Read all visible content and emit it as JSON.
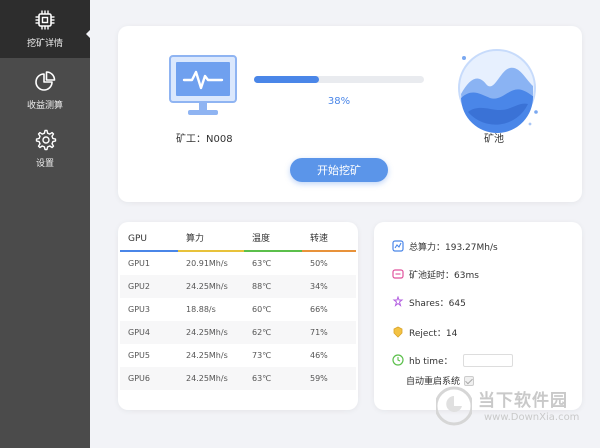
{
  "sidebar": {
    "items": [
      {
        "label": "挖矿详情",
        "icon": "chip-icon",
        "active": true
      },
      {
        "label": "收益测算",
        "icon": "pie-chart-icon",
        "active": false
      },
      {
        "label": "设置",
        "icon": "gear-icon",
        "active": false
      }
    ]
  },
  "mining": {
    "miner_label": "矿工：N008",
    "progress_text": "38%",
    "progress_value": 0.38,
    "pool_label": "矿池",
    "start_button": "开始挖矿"
  },
  "gpu_table": {
    "headers": [
      "GPU",
      "算力",
      "温度",
      "转速"
    ],
    "header_colors": [
      "#4a86e8",
      "#e8c23a",
      "#5bbf4b",
      "#e8923a"
    ],
    "rows": [
      [
        "GPU1",
        "20.91Mh/s",
        "63℃",
        "50%"
      ],
      [
        "GPU2",
        "24.25Mh/s",
        "88℃",
        "34%"
      ],
      [
        "GPU3",
        "18.88/s",
        "60℃",
        "66%"
      ],
      [
        "GPU4",
        "24.25Mh/s",
        "62℃",
        "71%"
      ],
      [
        "GPU5",
        "24.25Mh/s",
        "73℃",
        "46%"
      ],
      [
        "GPU6",
        "24.25Mh/s",
        "63℃",
        "59%"
      ]
    ]
  },
  "stats": {
    "total_hashrate": "总算力：193.27Mh/s",
    "pool_latency": "矿池延时：63ms",
    "shares": "Shares：645",
    "reject": "Reject：14",
    "hb_time_label": "hb time：",
    "hb_time_value": "",
    "auto_restart_label": "自动重启系统",
    "auto_restart_checked": true
  },
  "watermark": {
    "title": "当下软件园",
    "url": "www.DownXia.com"
  },
  "colors": {
    "accent": "#4a86e8",
    "sidebar_bg": "#4b4b4b",
    "sidebar_active": "#2d2d2d"
  }
}
